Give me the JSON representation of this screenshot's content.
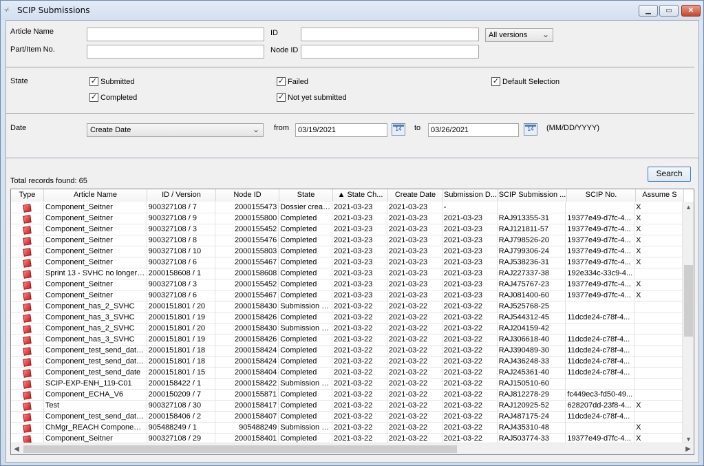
{
  "window": {
    "title": "SCIP Submissions",
    "app_icon": "~⁄·"
  },
  "filters": {
    "article_name_label": "Article Name",
    "article_name_value": "",
    "part_item_label": "Part/Item No.",
    "part_item_value": "",
    "id_label": "ID",
    "id_value": "",
    "node_id_label": "Node ID",
    "node_id_value": "",
    "versions_value": "All versions",
    "state_label": "State",
    "states": [
      {
        "label": "Submitted",
        "checked": true
      },
      {
        "label": "Completed",
        "checked": true
      },
      {
        "label": "Failed",
        "checked": true
      },
      {
        "label": "Not yet submitted",
        "checked": true
      },
      {
        "label": "Default Selection",
        "checked": true
      }
    ],
    "date_label": "Date",
    "date_type_value": "Create Date",
    "from_label": "from",
    "from_value": "03/19/2021",
    "to_label": "to",
    "to_value": "03/26/2021",
    "date_format_hint": "(MM/DD/YYYY)",
    "calendar_icon_text": "14"
  },
  "results": {
    "total_text": "Total records found: 65",
    "search_label": "Search",
    "columns": [
      "Type",
      "Article Name",
      "ID / Version",
      "Node ID",
      "State",
      "▲ State Ch...",
      "Create Date",
      "Submission D...",
      "SCIP Submission ...",
      "SCIP No.",
      "Assume S"
    ],
    "rows": [
      [
        "Component_Seitner",
        "900327108 / 7",
        "2000155473",
        "Dossier creati...",
        "2021-03-23",
        "2021-03-23",
        "-",
        "",
        "",
        "X"
      ],
      [
        "Component_Seitner",
        "900327108 / 9",
        "2000155800",
        "Completed",
        "2021-03-23",
        "2021-03-23",
        "2021-03-23",
        "RAJ913355-31",
        "19377e49-d7fc-4...",
        "X"
      ],
      [
        "Component_Seitner",
        "900327108 / 3",
        "2000155452",
        "Completed",
        "2021-03-23",
        "2021-03-23",
        "2021-03-23",
        "RAJ121811-57",
        "19377e49-d7fc-4...",
        "X"
      ],
      [
        "Component_Seitner",
        "900327108 / 8",
        "2000155476",
        "Completed",
        "2021-03-23",
        "2021-03-23",
        "2021-03-23",
        "RAJ798526-20",
        "19377e49-d7fc-4...",
        "X"
      ],
      [
        "Component_Seitner",
        "900327108 / 10",
        "2000155803",
        "Completed",
        "2021-03-23",
        "2021-03-23",
        "2021-03-23",
        "RAJ799306-24",
        "19377e49-d7fc-4...",
        "X"
      ],
      [
        "Component_Seitner",
        "900327108 / 6",
        "2000155467",
        "Completed",
        "2021-03-23",
        "2021-03-23",
        "2021-03-23",
        "RAJ538236-31",
        "19377e49-d7fc-4...",
        "X"
      ],
      [
        "Sprint 13 - SVHC no longer p...",
        "2000158608 / 1",
        "2000158608",
        "Completed",
        "2021-03-23",
        "2021-03-23",
        "2021-03-23",
        "RAJ227337-38",
        "192e334c-33c9-4...",
        ""
      ],
      [
        "Component_Seitner",
        "900327108 / 3",
        "2000155452",
        "Completed",
        "2021-03-23",
        "2021-03-23",
        "2021-03-23",
        "RAJ475767-23",
        "19377e49-d7fc-4...",
        "X"
      ],
      [
        "Component_Seitner",
        "900327108 / 6",
        "2000155467",
        "Completed",
        "2021-03-23",
        "2021-03-23",
        "2021-03-23",
        "RAJ081400-60",
        "19377e49-d7fc-4...",
        "X"
      ],
      [
        "Component_has_2_SVHC",
        "2000151801 / 20",
        "2000158430",
        "Submission re...",
        "2021-03-22",
        "2021-03-22",
        "2021-03-22",
        "RAJ525768-25",
        "",
        ""
      ],
      [
        "Component_has_3_SVHC",
        "2000151801 / 19",
        "2000158426",
        "Completed",
        "2021-03-22",
        "2021-03-22",
        "2021-03-22",
        "RAJ544312-45",
        "11dcde24-c78f-4...",
        ""
      ],
      [
        "Component_has_2_SVHC",
        "2000151801 / 20",
        "2000158430",
        "Submission re...",
        "2021-03-22",
        "2021-03-22",
        "2021-03-22",
        "RAJ204159-42",
        "",
        ""
      ],
      [
        "Component_has_3_SVHC",
        "2000151801 / 19",
        "2000158426",
        "Completed",
        "2021-03-22",
        "2021-03-22",
        "2021-03-22",
        "RAJ306618-40",
        "11dcde24-c78f-4...",
        ""
      ],
      [
        "Component_test_send_date...",
        "2000151801 / 18",
        "2000158424",
        "Completed",
        "2021-03-22",
        "2021-03-22",
        "2021-03-22",
        "RAJ390489-30",
        "11dcde24-c78f-4...",
        ""
      ],
      [
        "Component_test_send_date...",
        "2000151801 / 18",
        "2000158424",
        "Completed",
        "2021-03-22",
        "2021-03-22",
        "2021-03-22",
        "RAJ436248-33",
        "11dcde24-c78f-4...",
        ""
      ],
      [
        "Component_test_send_date",
        "2000151801 / 15",
        "2000158404",
        "Completed",
        "2021-03-22",
        "2021-03-22",
        "2021-03-22",
        "RAJ245361-40",
        "11dcde24-c78f-4...",
        ""
      ],
      [
        "SCIP-EXP-ENH_119-C01",
        "2000158422 / 1",
        "2000158422",
        "Submission re...",
        "2021-03-22",
        "2021-03-22",
        "2021-03-22",
        "RAJ150510-60",
        "",
        ""
      ],
      [
        "Component_ECHA_V6",
        "2000150209 / 7",
        "2000155871",
        "Completed",
        "2021-03-22",
        "2021-03-22",
        "2021-03-22",
        "RAJ812278-29",
        "fc449ec3-fd50-49...",
        ""
      ],
      [
        "Test",
        "900327108 / 30",
        "2000158417",
        "Completed",
        "2021-03-22",
        "2021-03-22",
        "2021-03-22",
        "RAJ120925-52",
        "628207dd-23f8-4...",
        "X"
      ],
      [
        "Component_test_send_date...",
        "2000158406 / 2",
        "2000158407",
        "Completed",
        "2021-03-22",
        "2021-03-22",
        "2021-03-22",
        "RAJ487175-24",
        "11dcde24-c78f-4...",
        ""
      ],
      [
        "ChMgr_REACH Component ...",
        "905488249 / 1",
        "905488249",
        "Submission re...",
        "2021-03-22",
        "2021-03-22",
        "2021-03-22",
        "RAJ435310-48",
        "",
        "X"
      ],
      [
        "Component_Seitner",
        "900327108 / 29",
        "2000158401",
        "Completed",
        "2021-03-22",
        "2021-03-22",
        "2021-03-22",
        "RAJ503774-33",
        "19377e49-d7fc-4...",
        "X"
      ]
    ]
  },
  "icons": {
    "row_type": "red-part-cube-icon",
    "calendar": "calendar-icon"
  },
  "colors": {
    "accent": "#3c7fb1",
    "cube": "#d21b1b"
  }
}
